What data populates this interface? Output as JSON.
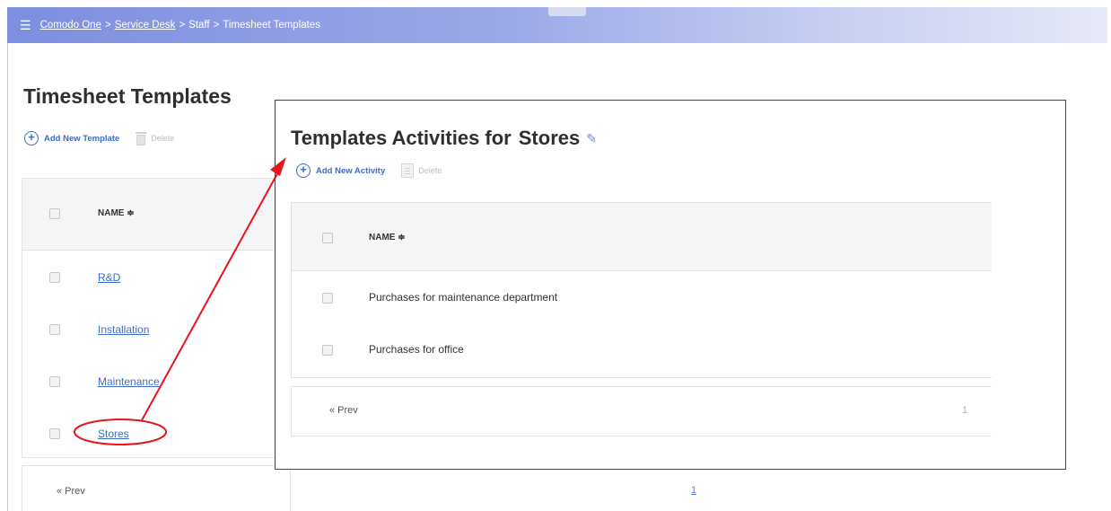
{
  "header": {
    "breadcrumb": [
      {
        "label": "Comodo One",
        "link": true
      },
      {
        "label": "Service Desk",
        "link": true
      },
      {
        "label": "Staff",
        "link": false
      },
      {
        "label": "Timesheet Templates",
        "link": false
      }
    ],
    "separator": ">",
    "menu_icon": "hamburger-menu-icon"
  },
  "page": {
    "title": "Timesheet Templates",
    "add_label": "Add New Template",
    "delete_label": "Delete",
    "table": {
      "column_name": "NAME ≑",
      "rows": [
        "R&D",
        "Installation",
        "Maintenance",
        "Stores"
      ]
    },
    "pager": {
      "prev": "« Prev",
      "page": "1"
    }
  },
  "overlay": {
    "title_prefix": "Templates Activities for",
    "template_name": "Stores",
    "add_label": "Add New Activity",
    "delete_label": "Delete",
    "table": {
      "column_name": "NAME ≑",
      "rows": [
        "Purchases for maintenance department",
        "Purchases for office"
      ]
    },
    "pager": {
      "prev": "« Prev",
      "page": "1"
    }
  },
  "colors": {
    "accent": "#3f6cc7",
    "annotation": "#e8141c",
    "header_gradient_start": "#7e8ee0"
  }
}
